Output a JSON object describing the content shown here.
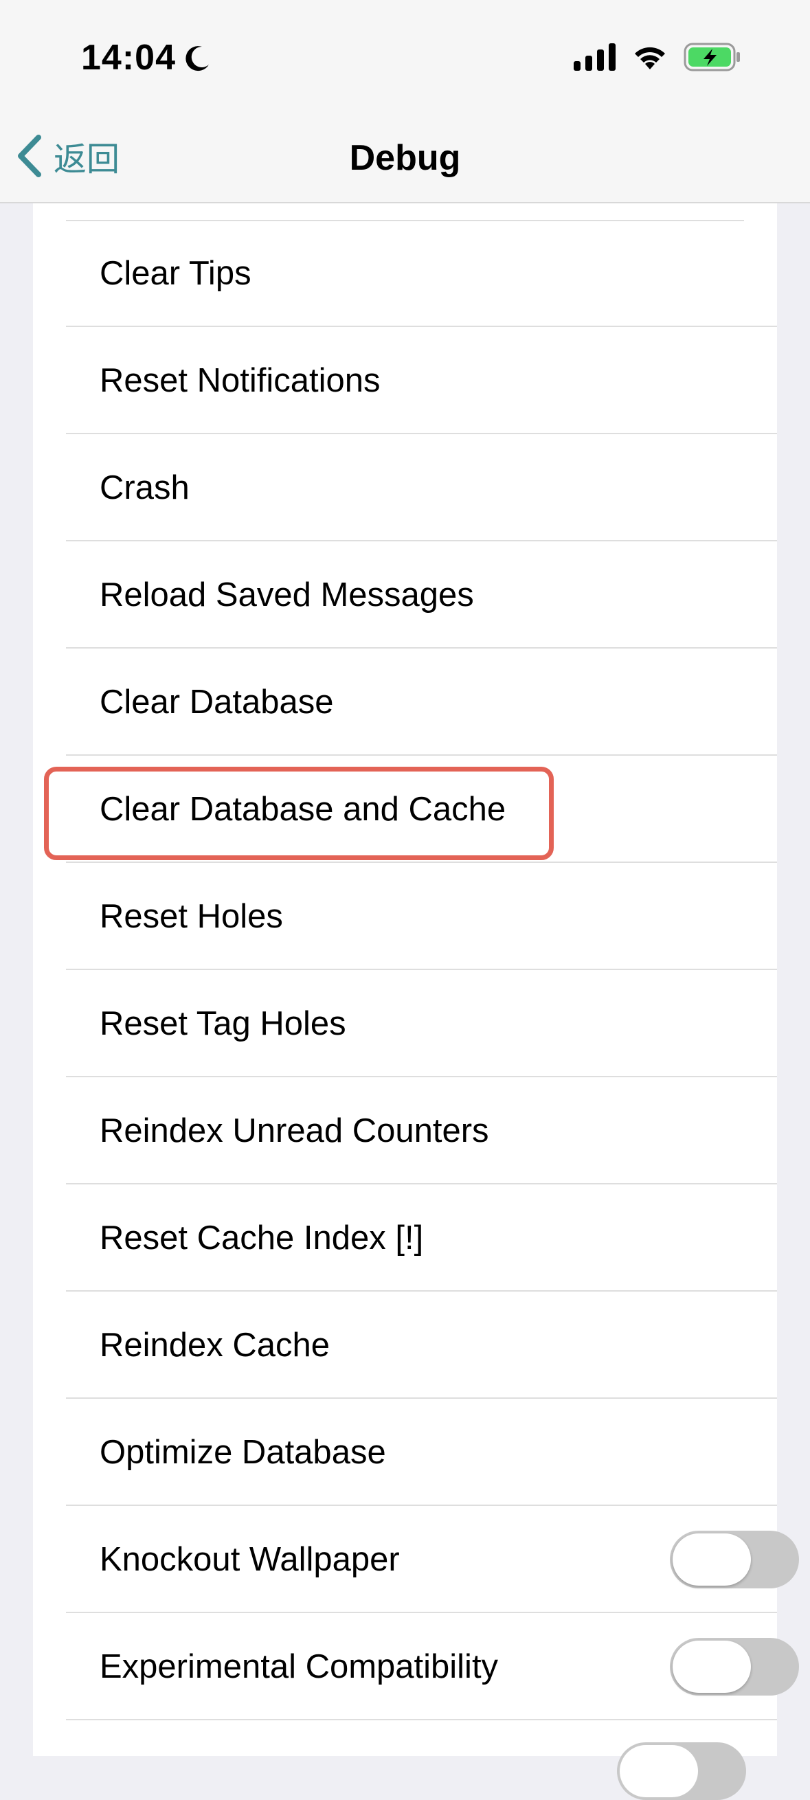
{
  "status_bar": {
    "time": "14:04",
    "icons": [
      "moon-icon",
      "cellular-signal-icon",
      "wifi-icon",
      "battery-charging-icon"
    ]
  },
  "nav": {
    "back_label": "返回",
    "title": "Debug"
  },
  "colors": {
    "accent_teal": "#3d8b94",
    "destructive_red": "#d9574a",
    "highlight": "#e36356",
    "battery_green": "#4cd964"
  },
  "rows": [
    {
      "label": "Clear Tips",
      "style": "teal"
    },
    {
      "label": "Reset Notifications",
      "style": "teal"
    },
    {
      "label": "Crash",
      "style": "teal"
    },
    {
      "label": "Reload Saved Messages",
      "style": "teal"
    },
    {
      "label": "Clear Database",
      "style": "red"
    },
    {
      "label": "Clear Database and Cache",
      "style": "red",
      "highlighted": true
    },
    {
      "label": "Reset Holes",
      "style": "red"
    },
    {
      "label": "Reset Tag Holes",
      "style": "red"
    },
    {
      "label": "Reindex Unread Counters",
      "style": "red"
    },
    {
      "label": "Reset Cache Index [!]",
      "style": "red"
    },
    {
      "label": "Reindex Cache",
      "style": "red"
    },
    {
      "label": "Optimize Database",
      "style": "teal"
    },
    {
      "label": "Knockout Wallpaper",
      "style": "black",
      "toggle": true,
      "on": false
    },
    {
      "label": "Experimental Compatibility",
      "style": "black",
      "toggle": true,
      "on": false
    }
  ]
}
